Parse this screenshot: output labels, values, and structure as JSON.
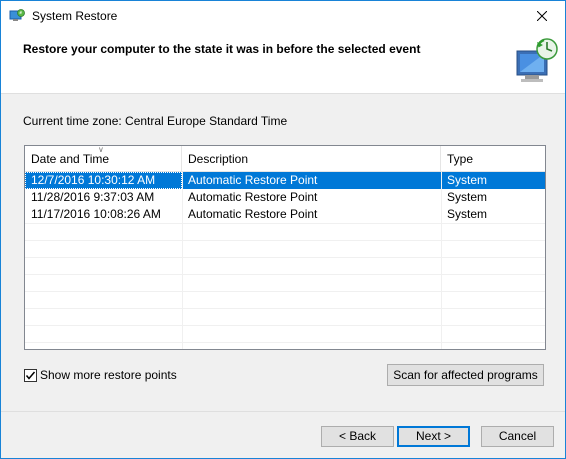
{
  "window": {
    "title": "System Restore"
  },
  "header": {
    "heading": "Restore your computer to the state it was in before the selected event"
  },
  "timezone_text": "Current time zone: Central Europe Standard Time",
  "table": {
    "columns": [
      "Date and Time",
      "Description",
      "Type"
    ],
    "rows": [
      {
        "date": "12/7/2016 10:30:12 AM",
        "description": "Automatic Restore Point",
        "type": "System",
        "selected": true
      },
      {
        "date": "11/28/2016 9:37:03 AM",
        "description": "Automatic Restore Point",
        "type": "System",
        "selected": false
      },
      {
        "date": "11/17/2016 10:08:26 AM",
        "description": "Automatic Restore Point",
        "type": "System",
        "selected": false
      }
    ]
  },
  "options": {
    "show_more_label": "Show more restore points",
    "show_more_checked": true
  },
  "buttons": {
    "scan": "Scan for affected programs",
    "back": "< Back",
    "next": "Next >",
    "cancel": "Cancel"
  },
  "colors": {
    "selection": "#0078d7",
    "border_accent": "#1883d7"
  }
}
